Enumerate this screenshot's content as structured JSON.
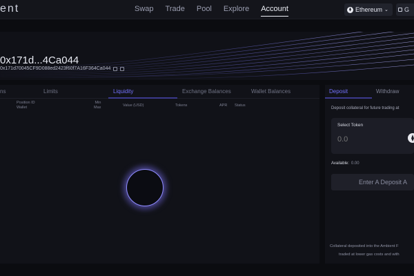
{
  "header": {
    "logo_text": "ent",
    "nav": [
      "Swap",
      "Trade",
      "Pool",
      "Explore",
      "Account"
    ],
    "active_nav": "Account",
    "network_label": "Ethereum",
    "network_icon": "ethereum-icon",
    "wallet_label": "G"
  },
  "profile": {
    "address_short": "0x171d...4Ca044",
    "address_full": "0x171d70045CF9D088ed2423f60f7A16F364Ca044"
  },
  "left_panel": {
    "tabs": [
      "ns",
      "Limits",
      "Liquidity",
      "Exchange Balances",
      "Wallet Balances"
    ],
    "active_tab": "Liquidity",
    "columns": {
      "position_id": "Position ID",
      "wallet": "Wallet",
      "min": "Min",
      "max": "Max",
      "value": "Value (USD)",
      "tokens": "Tokens",
      "apr": "APR",
      "status": "Status"
    }
  },
  "right_panel": {
    "tabs": [
      "Deposit",
      "Withdraw"
    ],
    "active_tab": "Deposit",
    "description": "Deposit collateral for future trading at",
    "select_token_label": "Select Token",
    "amount_placeholder": "0.0",
    "available_label": "Available:",
    "available_value": "0.00",
    "button_label": "Enter A Deposit A",
    "footer_line1": "Collateral deposited into the Ambient F",
    "footer_line2": "traded at lower gas costs and with"
  },
  "colors": {
    "accent": "#7371fc",
    "background": "#0b0c10",
    "panel": "#111218"
  }
}
